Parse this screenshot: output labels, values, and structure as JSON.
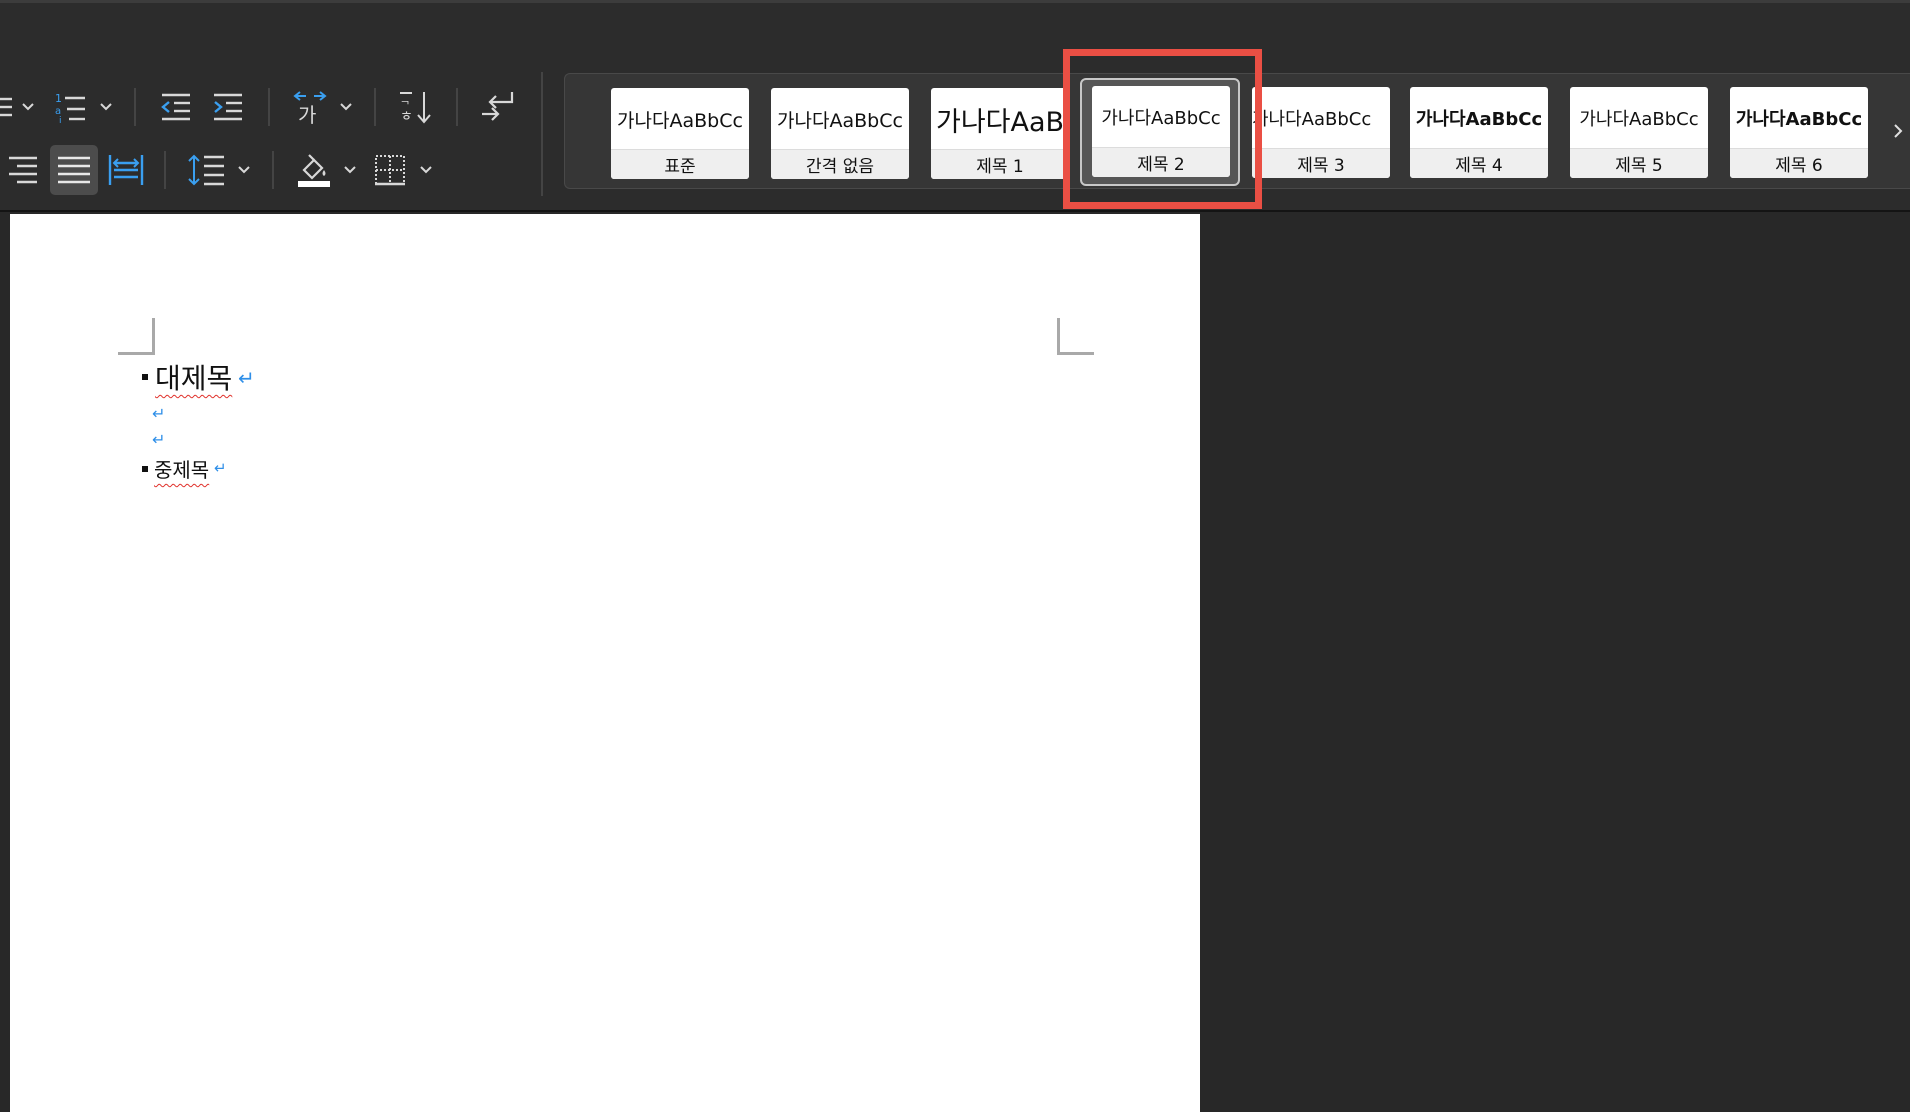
{
  "style_gallery": {
    "styles": [
      {
        "preview": "가나다AaBbCc",
        "label": "표준"
      },
      {
        "preview": "가나다AaBbCc",
        "label": "간격 없음"
      },
      {
        "preview": "가나다AaB",
        "label": "제목 1"
      },
      {
        "preview": "가나다AaBbCc",
        "label": "제목 2"
      },
      {
        "preview": "가나다AaBbCc",
        "label": "제목 3"
      },
      {
        "preview": "가나다AaBbCc",
        "label": "제목 4"
      },
      {
        "preview": "가나다AaBbCc",
        "label": "제목 5"
      },
      {
        "preview": "가나다AaBbCc",
        "label": "제목 6"
      }
    ],
    "selected": "제목 2"
  },
  "document": {
    "lines": [
      {
        "text": "대제목",
        "bullet": true
      },
      {
        "text": "",
        "bullet": false
      },
      {
        "text": "",
        "bullet": false
      },
      {
        "text": "중제목",
        "bullet": true
      }
    ],
    "paragraph_mark": "↵"
  },
  "colors": {
    "highlight": "#ea4f44",
    "paragraph_mark": "#2f8fe8",
    "spelling_underline": "#e0302a",
    "icon_accent": "#3a9ff0"
  }
}
